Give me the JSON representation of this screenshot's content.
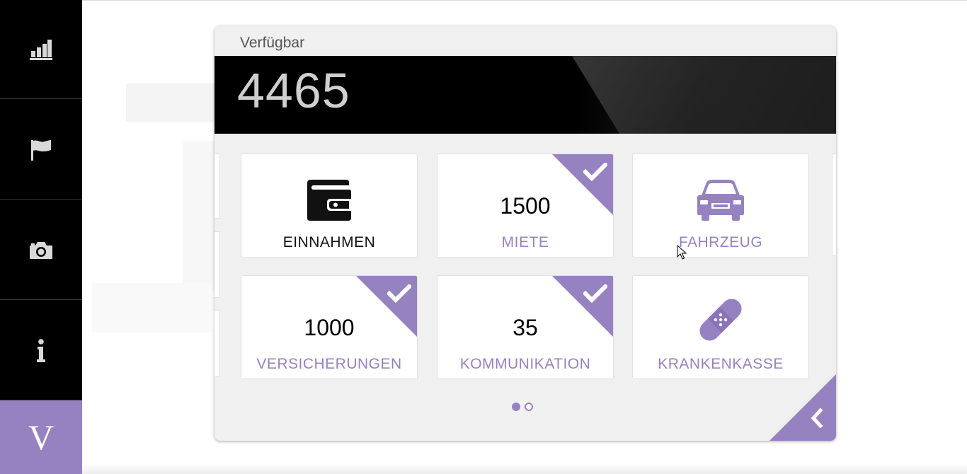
{
  "sidebar": {
    "items": [
      {
        "icon": "bar-chart-icon"
      },
      {
        "icon": "flag-icon"
      },
      {
        "icon": "camera-icon"
      },
      {
        "icon": "info-icon"
      }
    ],
    "logo_letter": "V"
  },
  "panel": {
    "title": "Verfügbar",
    "amount": "4465"
  },
  "cards": [
    {
      "label": "EINNAHMEN",
      "icon": "wallet-icon",
      "value": "",
      "checked": false
    },
    {
      "label": "MIETE",
      "icon": "",
      "value": "1500",
      "checked": true
    },
    {
      "label": "FAHRZEUG",
      "icon": "car-icon",
      "value": "",
      "checked": false
    },
    {
      "label": "VERSICHERUNGEN",
      "icon": "",
      "value": "1000",
      "checked": true
    },
    {
      "label": "KOMMUNIKATION",
      "icon": "",
      "value": "35",
      "checked": true
    },
    {
      "label": "KRANKENKASSE",
      "icon": "bandage-icon",
      "value": "",
      "checked": false
    }
  ],
  "pager": {
    "pages": 2,
    "current": 1
  },
  "colors": {
    "accent": "#9782c1",
    "sidebar": "#000000",
    "panel": "#f0f0f0"
  }
}
